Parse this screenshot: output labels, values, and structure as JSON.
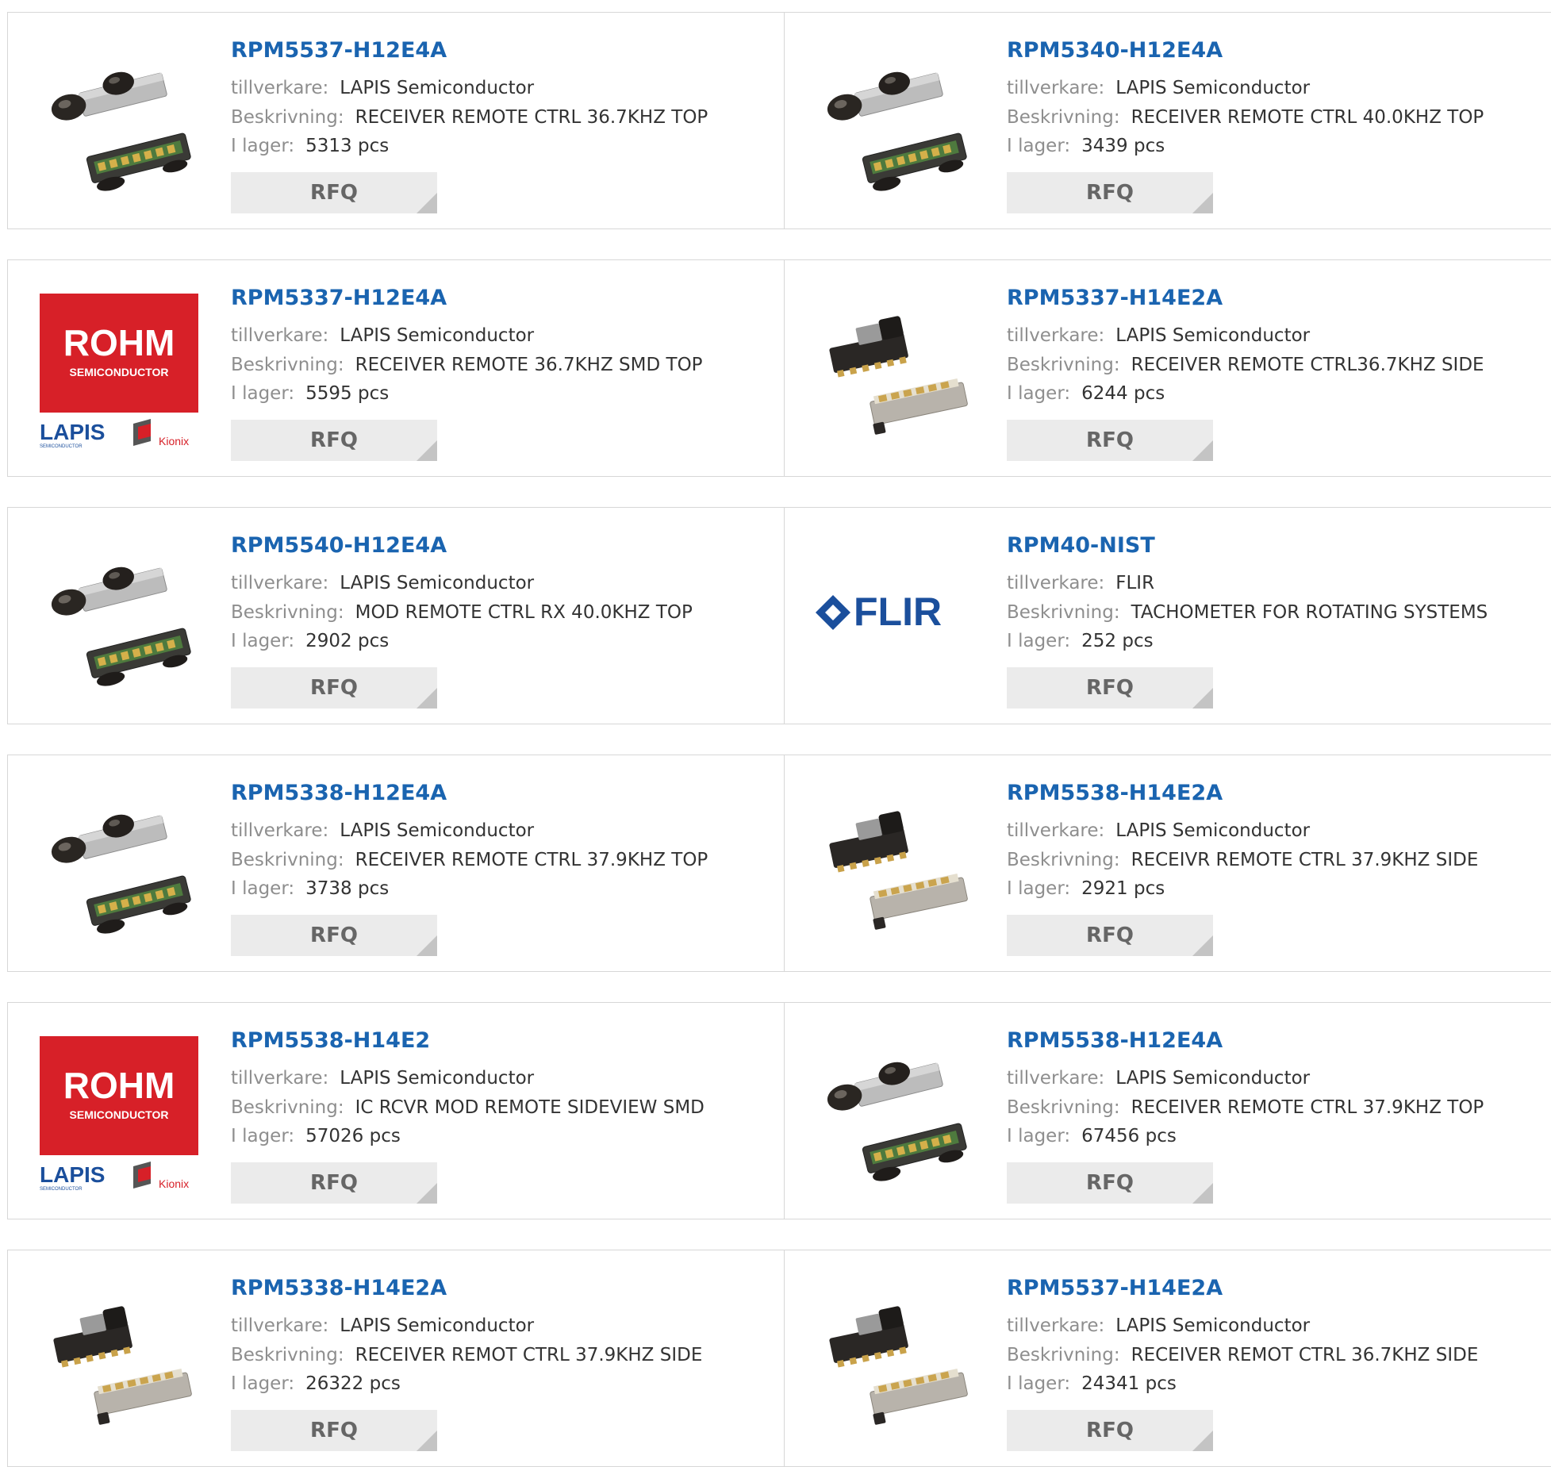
{
  "labels": {
    "manufacturer": "tillverkare:",
    "description": "Beskrivning:",
    "stock": "I lager:",
    "rfq": "RFQ"
  },
  "rohm_logo": {
    "brand": "ROHM",
    "brand_sub": "SEMICONDUCTOR",
    "lapis": "LAPIS",
    "lapis_sub": "SEMICONDUCTOR",
    "kionix": "Kionix"
  },
  "flir_logo": {
    "brand": "FLIR"
  },
  "colors": {
    "link": "#1a64b0",
    "rohm_red": "#d72028",
    "flir_blue": "#1b4f9c"
  },
  "products": [
    {
      "part": "RPM5537-H12E4A",
      "manufacturer": "LAPIS Semiconductor",
      "description": "RECEIVER REMOTE CTRL 36.7KHZ TOP",
      "stock": "5313 pcs",
      "image": "top-module-icon"
    },
    {
      "part": "RPM5340-H12E4A",
      "manufacturer": "LAPIS Semiconductor",
      "description": "RECEIVER REMOTE CTRL 40.0KHZ TOP",
      "stock": "3439 pcs",
      "image": "top-module-icon"
    },
    {
      "part": "RPM5337-H12E4A",
      "manufacturer": "LAPIS Semiconductor",
      "description": "RECEIVER REMOTE 36.7KHZ SMD TOP",
      "stock": "5595 pcs",
      "image": "rohm-logo"
    },
    {
      "part": "RPM5337-H14E2A",
      "manufacturer": "LAPIS Semiconductor",
      "description": "RECEIVER REMOTE CTRL36.7KHZ SIDE",
      "stock": "6244 pcs",
      "image": "side-module-icon"
    },
    {
      "part": "RPM5540-H12E4A",
      "manufacturer": "LAPIS Semiconductor",
      "description": "MOD REMOTE CTRL RX 40.0KHZ TOP",
      "stock": "2902 pcs",
      "image": "top-module-icon"
    },
    {
      "part": "RPM40-NIST",
      "manufacturer": "FLIR",
      "description": "TACHOMETER FOR ROTATING SYSTEMS",
      "stock": "252 pcs",
      "image": "flir-logo"
    },
    {
      "part": "RPM5338-H12E4A",
      "manufacturer": "LAPIS Semiconductor",
      "description": "RECEIVER REMOTE CTRL 37.9KHZ TOP",
      "stock": "3738 pcs",
      "image": "top-module-icon"
    },
    {
      "part": "RPM5538-H14E2A",
      "manufacturer": "LAPIS Semiconductor",
      "description": "RECEIVR REMOTE CTRL 37.9KHZ SIDE",
      "stock": "2921 pcs",
      "image": "side-module-icon"
    },
    {
      "part": "RPM5538-H14E2",
      "manufacturer": "LAPIS Semiconductor",
      "description": "IC RCVR MOD REMOTE SIDEVIEW SMD",
      "stock": "57026 pcs",
      "image": "rohm-logo"
    },
    {
      "part": "RPM5538-H12E4A",
      "manufacturer": "LAPIS Semiconductor",
      "description": "RECEIVER REMOTE CTRL 37.9KHZ TOP",
      "stock": "67456 pcs",
      "image": "top-module-icon"
    },
    {
      "part": "RPM5338-H14E2A",
      "manufacturer": "LAPIS Semiconductor",
      "description": "RECEIVER REMOT CTRL 37.9KHZ SIDE",
      "stock": "26322 pcs",
      "image": "side-module-icon"
    },
    {
      "part": "RPM5537-H14E2A",
      "manufacturer": "LAPIS Semiconductor",
      "description": "RECEIVER REMOT CTRL 36.7KHZ SIDE",
      "stock": "24341 pcs",
      "image": "side-module-icon"
    }
  ]
}
